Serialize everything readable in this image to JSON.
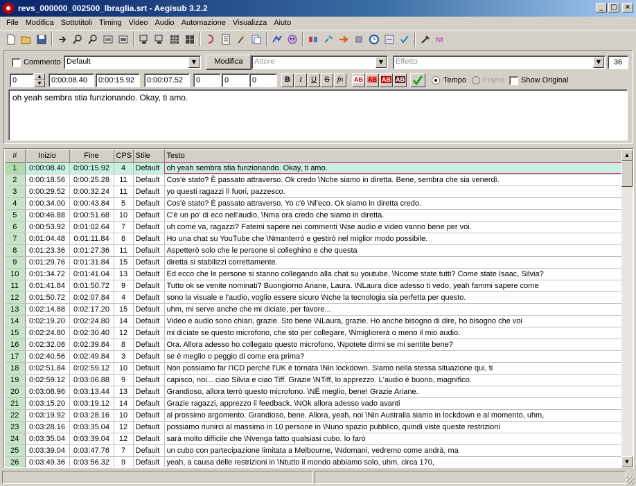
{
  "window": {
    "title": "revs_000000_002500_lbraglia.srt - Aegisub 3.2.2",
    "minimize_glyph": "_",
    "maximize_glyph": "□",
    "close_glyph": "×"
  },
  "menu": [
    "File",
    "Modifica",
    "Sottotitoli",
    "Timing",
    "Video",
    "Audio",
    "Automazione",
    "Visualizza",
    "Aiuto"
  ],
  "toolbar_icons": [
    "new-file-icon",
    "open-folder-icon",
    "save-icon",
    "jump-to-icon",
    "zoom-in-icon",
    "zoom-out-icon",
    "snap-start-icon",
    "snap-end-icon",
    "video-details-icon",
    "video-frame-icon",
    "video-grid-icon",
    "video-keyframe-icon",
    "automation-icon",
    "styles-manager-icon",
    "attachments-icon",
    "properties-icon",
    "translation-icon",
    "spellcheck-icon",
    "resample-icon",
    "find-icon",
    "shift-times-icon",
    "timing-postprocessor-icon",
    "kanji-timer-icon",
    "fonts-collector-icon",
    "select-lines-icon",
    "clock-icon",
    "tools-icon",
    "cut-icon",
    "nt-icon"
  ],
  "editor": {
    "comment_label": "Commento",
    "style": "Default",
    "modify_label": "Modifica",
    "actor_placeholder": "Attore",
    "effect_placeholder": "Effetto",
    "char_count": "36",
    "layer": "0",
    "start": "0:00:08.40",
    "end": "0:00:15.92",
    "duration": "0:00:07.52",
    "margin_l": "0",
    "margin_r": "0",
    "margin_v": "0",
    "bold": "B",
    "italic": "I",
    "underline": "U",
    "strike": "S",
    "fn": "fn",
    "color_label": "AB",
    "time_label": "Tempo",
    "frame_label": "Frame",
    "show_original_label": "Show Original",
    "text": "oh yeah sembra stia funzionando. Okay, ti amo."
  },
  "grid": {
    "headers": [
      "#",
      "Inizio",
      "Fine",
      "CPS",
      "Stile",
      "Testo"
    ],
    "selected_row": 1,
    "rows": [
      [
        "1",
        "0:00:08.40",
        "0:00:15.92",
        "4",
        "Default",
        "oh yeah sembra stia funzionando. Okay, ti amo."
      ],
      [
        "2",
        "0:00:18.56",
        "0:00:25.28",
        "11",
        "Default",
        "Cos'è stato? È passato attraverso. Ok credo \\Nche siamo in diretta. Bene, sembra che sia venerdì."
      ],
      [
        "3",
        "0:00:29.52",
        "0:00:32.24",
        "11",
        "Default",
        "yo questi ragazzi lì fuori, pazzesco."
      ],
      [
        "4",
        "0:00:34.00",
        "0:00:43.84",
        "5",
        "Default",
        "Cos'è stato? È passato attraverso. Yo c'è \\Nl'eco. Ok siamo in diretta credo."
      ],
      [
        "5",
        "0:00:46.88",
        "0:00:51.68",
        "10",
        "Default",
        "C'è un po' di eco nell'audio, \\Nma ora credo che siamo in diretta."
      ],
      [
        "6",
        "0:00:53.92",
        "0:01:02.64",
        "7",
        "Default",
        "uh come va, ragazzi? Fatemi sapere nei commenti \\Nse audio e video vanno bene per voi."
      ],
      [
        "7",
        "0:01:04.48",
        "0:01:11.84",
        "8",
        "Default",
        "Ho una chat su YouTube che \\Nmanterrò e gestirò nel miglior modo possibile."
      ],
      [
        "8",
        "0:01:23.36",
        "0:01:27.36",
        "11",
        "Default",
        "Aspetterò solo che le persone si colleghino e che questa"
      ],
      [
        "9",
        "0:01:29.76",
        "0:01:31.84",
        "15",
        "Default",
        "diretta si stabilizzi correttamente."
      ],
      [
        "10",
        "0:01:34.72",
        "0:01:41.04",
        "13",
        "Default",
        "Ed ecco che le persone si stanno collegando alla chat su youtube, \\Ncome state tutti? Come state Isaac, Silvia?"
      ],
      [
        "11",
        "0:01:41.84",
        "0:01:50.72",
        "9",
        "Default",
        "Tutto ok se venite nominati? Buongiorno Ariane, Laura. \\NLaura dice adesso ti vedo, yeah fammi sapere come"
      ],
      [
        "12",
        "0:01:50.72",
        "0:02:07.84",
        "4",
        "Default",
        "sono la visuale e l'audio, voglio essere sicuro \\Nche la tecnologia sia perfetta per questo."
      ],
      [
        "13",
        "0:02:14.88",
        "0:02:17.20",
        "15",
        "Default",
        "uhm, mi serve anche che mi diciate, per favore..."
      ],
      [
        "14",
        "0:02:19.20",
        "0:02:24.80",
        "14",
        "Default",
        "Video e audio sono chiari, grazie. Sto bene \\NLaura, grazie. Ho anche bisogno di dire, ho bisogno che voi"
      ],
      [
        "15",
        "0:02:24.80",
        "0:02:30.40",
        "12",
        "Default",
        "mi diciate se questo microfono, che sto per collegare, \\Nmigliorerà o meno il mio audio."
      ],
      [
        "16",
        "0:02:32.08",
        "0:02:39.84",
        "8",
        "Default",
        "Ora. Allora adesso ho collegato questo microfono, \\Npotete dirmi se mi sentite bene?"
      ],
      [
        "17",
        "0:02:40.56",
        "0:02:49.84",
        "3",
        "Default",
        "se è meglio o peggio di come era prima?"
      ],
      [
        "18",
        "0:02:51.84",
        "0:02:59.12",
        "10",
        "Default",
        "Non possiamo far l'ICD perché l'UK è tornata \\Nin lockdown. Siamo nella stessa situazione qui, ti"
      ],
      [
        "19",
        "0:02:59.12",
        "0:03:06.88",
        "9",
        "Default",
        "capisco, noi... ciao Silvia e ciao Tiff. Grazie \\NTiff, lo apprezzo. L'audio è buono, magnifico."
      ],
      [
        "20",
        "0:03:08.96",
        "0:03:13.44",
        "13",
        "Default",
        "Grandioso, allora terrò questo microfono. \\NÈ meglio, bene! Grazie Ariane."
      ],
      [
        "21",
        "0:03:15.20",
        "0:03:19.12",
        "14",
        "Default",
        "Grazie ragazzi, apprezzo il feedback. \\NOk allora adesso vado avanti"
      ],
      [
        "22",
        "0:03:19.92",
        "0:03:28.16",
        "10",
        "Default",
        "al prossimo argomento. Grandioso, bene. Allora, yeah, noi \\Nin Australia siamo in lockdown e al momento, uhm,"
      ],
      [
        "23",
        "0:03:28.16",
        "0:03:35.04",
        "12",
        "Default",
        "possiamo riunirci al massimo in 10 persone in \\Nuno spazio pubblico, quindi viste queste restrizioni"
      ],
      [
        "24",
        "0:03:35.04",
        "0:03:39.04",
        "12",
        "Default",
        "sarà molto difficile che \\Nvenga fatto qualsiasi cubo. Io farò"
      ],
      [
        "25",
        "0:03:39.04",
        "0:03:47.76",
        "7",
        "Default",
        "un cubo con partecipazione limitata a Melbourne, \\Ndomani, vedremo come andrà, ma"
      ],
      [
        "26",
        "0:03:49.36",
        "0:03:56.32",
        "9",
        "Default",
        "yeah, a causa delle restrizioni in \\Ntutto il mondo abbiamo solo, uhm, circa 170,"
      ]
    ]
  }
}
